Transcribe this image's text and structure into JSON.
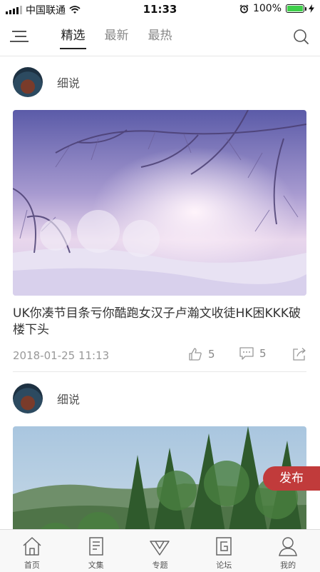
{
  "status_bar": {
    "carrier": "中国联通",
    "time": "11:33",
    "battery_text": "100%",
    "battery_level": 1.0,
    "icons": [
      "signal-icon",
      "wifi-icon",
      "alarm-icon",
      "battery-icon",
      "charging-icon"
    ]
  },
  "nav": {
    "menu_icon": "menu-icon",
    "tabs": [
      {
        "label": "精选",
        "active": true
      },
      {
        "label": "最新",
        "active": false
      },
      {
        "label": "最热",
        "active": false
      }
    ],
    "search_icon": "search-icon"
  },
  "posts": [
    {
      "author": "细说",
      "image": "winter-forest-snow",
      "title": "UK你凑节目条亏你酷跑女汉子卢瀚文收徒HK困KKK破楼下头",
      "date": "2018-01-25 11:13",
      "likes": "5",
      "comments": "5"
    },
    {
      "author": "细说",
      "image": "green-mountain-forest"
    }
  ],
  "publish_button": "发布",
  "tabbar": [
    {
      "label": "首页",
      "icon": "home-icon"
    },
    {
      "label": "文集",
      "icon": "book-icon"
    },
    {
      "label": "专题",
      "icon": "diamond-icon"
    },
    {
      "label": "论坛",
      "icon": "forum-icon"
    },
    {
      "label": "我的",
      "icon": "profile-icon"
    }
  ],
  "colors": {
    "accent": "#c13b3b",
    "battery": "#3ecf4a",
    "active_text": "#222222",
    "inactive_text": "#888888"
  }
}
